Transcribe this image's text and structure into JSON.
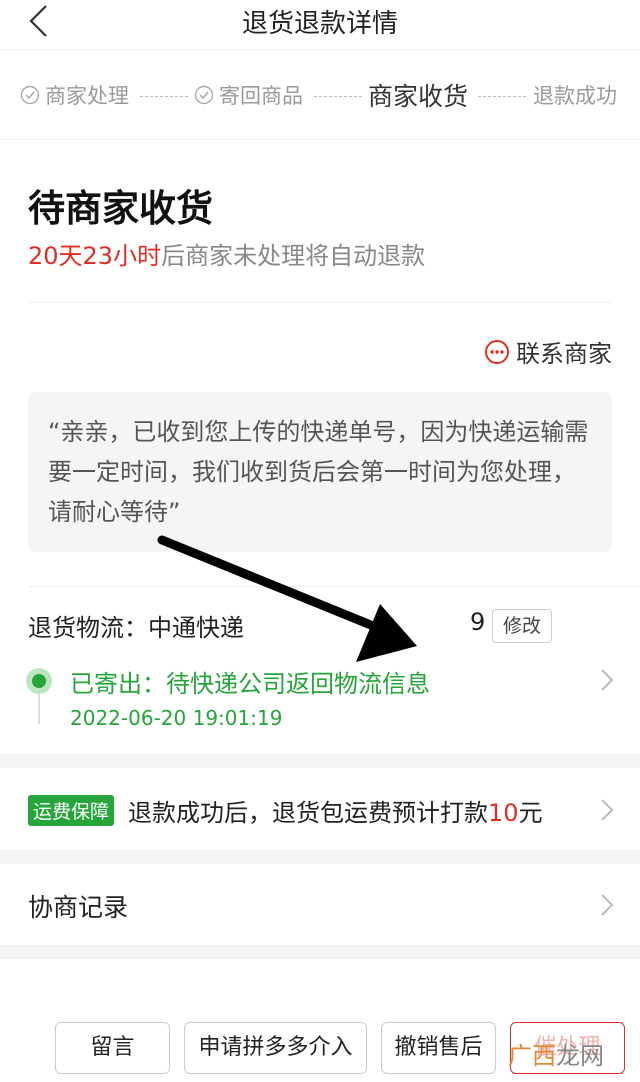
{
  "nav": {
    "title": "退货退款详情"
  },
  "steps": [
    {
      "label": "商家处理",
      "done": true
    },
    {
      "label": "寄回商品",
      "done": true
    },
    {
      "label": "商家收货",
      "active": true
    },
    {
      "label": "退款成功",
      "done": false
    }
  ],
  "status": {
    "title": "待商家收货",
    "countdown": "20天23小时",
    "countdown_suffix": "后商家未处理将自动退款"
  },
  "contact": {
    "label": "联系商家"
  },
  "quote": {
    "text": "“亲亲，已收到您上传的快递单号，因为快递运输需要一定时间，我们收到货后会第一时间为您处理，请耐心等待”"
  },
  "logistics": {
    "label": "退货物流：",
    "carrier": "中通快递",
    "tracking_tail": "9",
    "modify_label": "修改",
    "status": "已寄出：待快递公司返回物流信息",
    "time": "2022-06-20 19:01:19"
  },
  "freight": {
    "badge": "运费保障",
    "text_before": "退款成功后，退货包运费预计打款",
    "amount": "10",
    "unit": "元"
  },
  "negotiation": {
    "label": "协商记录"
  },
  "actions": {
    "message": "留言",
    "intervene": "申请拼多多介入",
    "cancel": "撤销售后",
    "urge": "催处理"
  },
  "watermark": {
    "a": "广西",
    "b": "龙网"
  },
  "colors": {
    "accent_red": "#e02e24",
    "accent_green": "#25a53a"
  },
  "icons": [
    "back-icon",
    "check-circle-icon",
    "chat-icon",
    "chevron-right-icon",
    "arrow-annotation"
  ]
}
